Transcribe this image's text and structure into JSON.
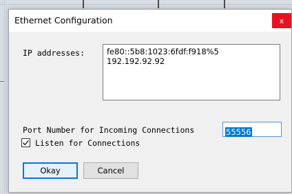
{
  "window": {
    "title": "Ethernet Configuration",
    "close_label": "x"
  },
  "ip_section": {
    "label": "IP addresses:",
    "addresses": [
      "fe80::5b8:1023:6fdf:f918%5",
      "192.192.92.92"
    ]
  },
  "port_section": {
    "label": "Port Number for Incoming Connections",
    "value": "55556"
  },
  "listen_checkbox": {
    "label": "Listen for Connections",
    "checked": true
  },
  "buttons": {
    "okay": "Okay",
    "cancel": "Cancel"
  },
  "colors": {
    "close_red": "#e81123",
    "selection_blue": "#0078d7"
  }
}
